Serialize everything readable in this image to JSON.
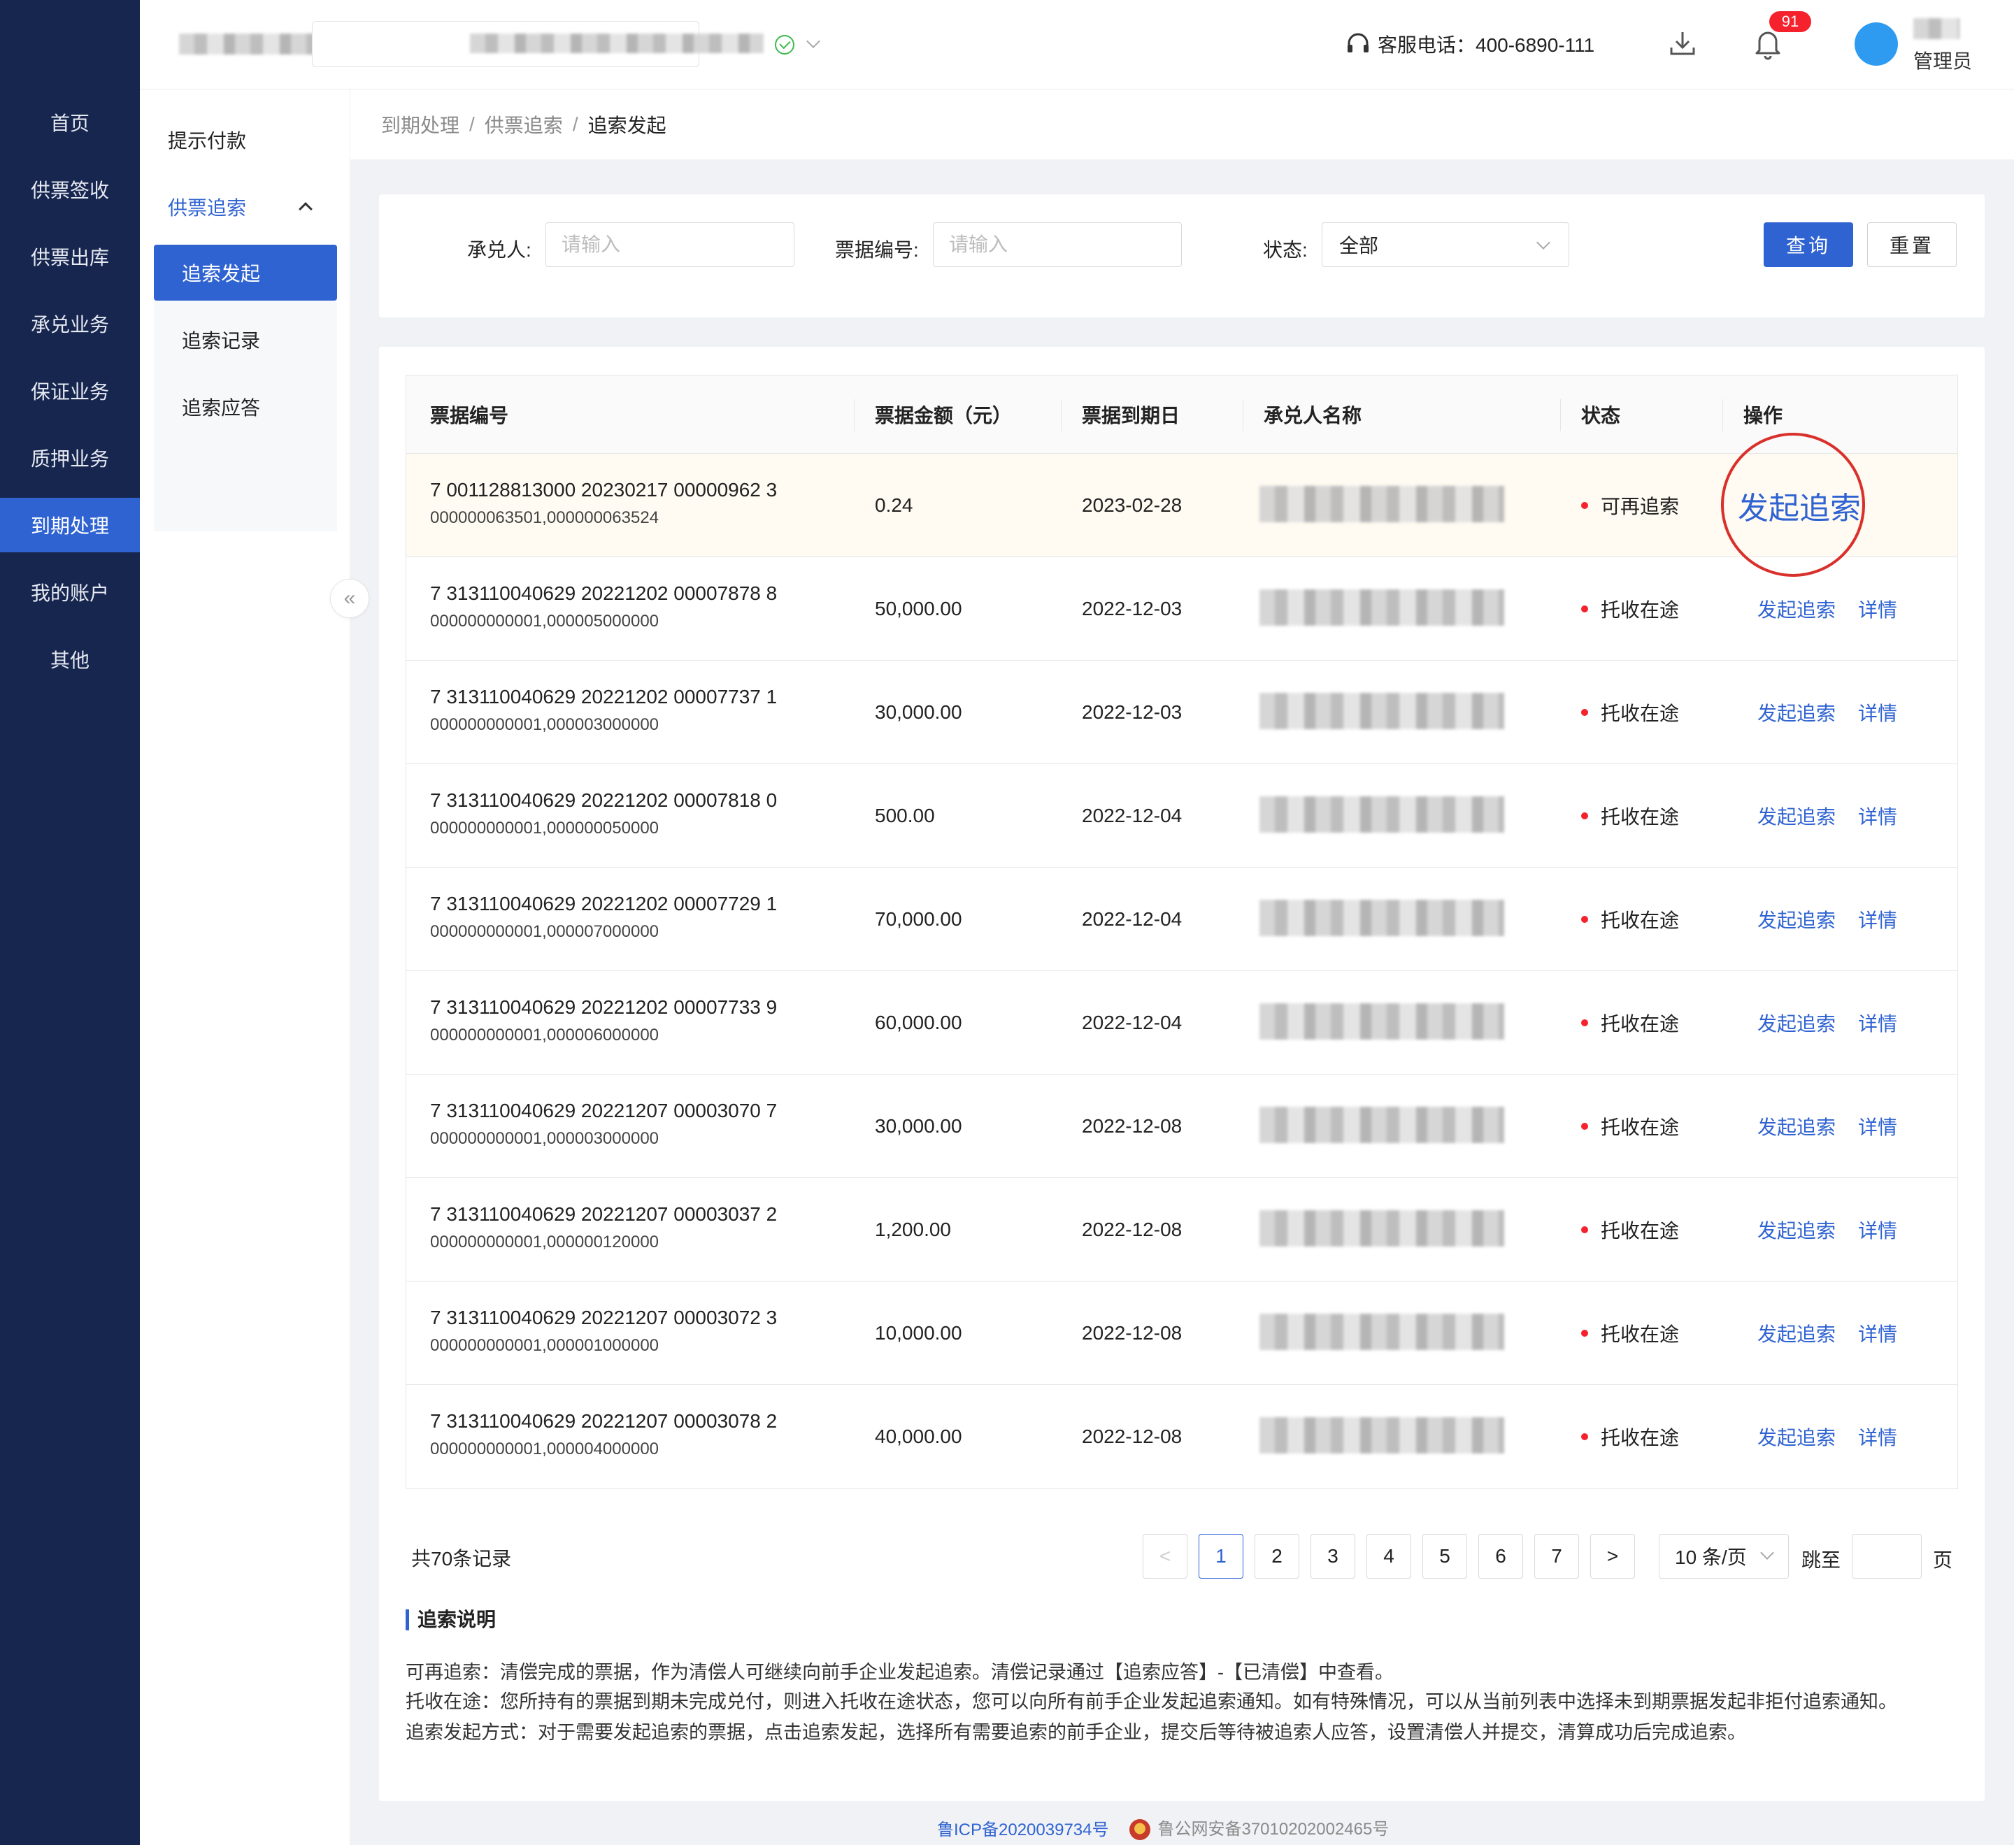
{
  "left_nav": [
    {
      "label": "首页"
    },
    {
      "label": "供票签收"
    },
    {
      "label": "供票出库"
    },
    {
      "label": "承兑业务"
    },
    {
      "label": "保证业务"
    },
    {
      "label": "质押业务"
    },
    {
      "label": "到期处理",
      "active": true
    },
    {
      "label": "我的账户"
    },
    {
      "label": "其他"
    }
  ],
  "header": {
    "hotline": "客服电话：400-6890-111",
    "notification_count": "91",
    "user_role": "管理员"
  },
  "sub_nav": {
    "item_prompt_payment": "提示付款",
    "group_recourse": "供票追索",
    "children": [
      {
        "label": "追索发起",
        "active": true
      },
      {
        "label": "追索记录"
      },
      {
        "label": "追索应答"
      }
    ],
    "collapse_glyph": "«"
  },
  "breadcrumb": [
    "到期处理",
    "供票追索",
    "追索发起"
  ],
  "breadcrumb_sep": "/",
  "filters": {
    "acceptor_label": "承兑人:",
    "acceptor_placeholder": "请输入",
    "bill_no_label": "票据编号:",
    "bill_no_placeholder": "请输入",
    "status_label": "状态:",
    "status_value": "全部",
    "query_button": "查询",
    "reset_button": "重置"
  },
  "table": {
    "columns": [
      "票据编号",
      "票据金额（元）",
      "票据到期日",
      "承兑人名称",
      "状态",
      "操作"
    ],
    "rows": [
      {
        "no": "7 001128813000 20230217 00000962 3",
        "range": "000000063501,000000063524",
        "amount": "0.24",
        "due": "2023-02-28",
        "status": "可再追索",
        "action": "发起追索",
        "detail": ""
      },
      {
        "no": "7 313110040629 20221202 00007878 8",
        "range": "000000000001,000005000000",
        "amount": "50,000.00",
        "due": "2022-12-03",
        "status": "托收在途",
        "action": "发起追索",
        "detail": "详情"
      },
      {
        "no": "7 313110040629 20221202 00007737 1",
        "range": "000000000001,000003000000",
        "amount": "30,000.00",
        "due": "2022-12-03",
        "status": "托收在途",
        "action": "发起追索",
        "detail": "详情"
      },
      {
        "no": "7 313110040629 20221202 00007818 0",
        "range": "000000000001,000000050000",
        "amount": "500.00",
        "due": "2022-12-04",
        "status": "托收在途",
        "action": "发起追索",
        "detail": "详情"
      },
      {
        "no": "7 313110040629 20221202 00007729 1",
        "range": "000000000001,000007000000",
        "amount": "70,000.00",
        "due": "2022-12-04",
        "status": "托收在途",
        "action": "发起追索",
        "detail": "详情"
      },
      {
        "no": "7 313110040629 20221202 00007733 9",
        "range": "000000000001,000006000000",
        "amount": "60,000.00",
        "due": "2022-12-04",
        "status": "托收在途",
        "action": "发起追索",
        "detail": "详情"
      },
      {
        "no": "7 313110040629 20221207 00003070 7",
        "range": "000000000001,000003000000",
        "amount": "30,000.00",
        "due": "2022-12-08",
        "status": "托收在途",
        "action": "发起追索",
        "detail": "详情"
      },
      {
        "no": "7 313110040629 20221207 00003037 2",
        "range": "000000000001,000000120000",
        "amount": "1,200.00",
        "due": "2022-12-08",
        "status": "托收在途",
        "action": "发起追索",
        "detail": "详情"
      },
      {
        "no": "7 313110040629 20221207 00003072 3",
        "range": "000000000001,000001000000",
        "amount": "10,000.00",
        "due": "2022-12-08",
        "status": "托收在途",
        "action": "发起追索",
        "detail": "详情"
      },
      {
        "no": "7 313110040629 20221207 00003078 2",
        "range": "000000000001,000004000000",
        "amount": "40,000.00",
        "due": "2022-12-08",
        "status": "托收在途",
        "action": "发起追索",
        "detail": "详情"
      }
    ]
  },
  "pagination": {
    "total": "共70条记录",
    "prev": "<",
    "next": ">",
    "pages": [
      "1",
      "2",
      "3",
      "4",
      "5",
      "6",
      "7"
    ],
    "current": "1",
    "page_size": "10 条/页",
    "jump_label": "跳至",
    "jump_unit": "页"
  },
  "notes": {
    "title": "追索说明",
    "lines": [
      "可再追索：清偿完成的票据，作为清偿人可继续向前手企业发起追索。清偿记录通过【追索应答】-【已清偿】中查看。",
      "托收在途：您所持有的票据到期未完成兑付，则进入托收在途状态，您可以向所有前手企业发起追索通知。如有特殊情况，可以从当前列表中选择未到期票据发起非拒付追索通知。",
      "追索发起方式：对于需要发起追索的票据，点击追索发起，选择所有需要追索的前手企业，提交后等待被追索人应答，设置清偿人并提交，清算成功后完成追索。"
    ]
  },
  "footer": {
    "icp": "鲁ICP备2020039734号",
    "police": "鲁公网安备37010202002465号"
  },
  "colors": {
    "nav_bg": "#17264f",
    "primary": "#2f63d1",
    "danger": "#f5222d",
    "highlight_row": "#fffaf2"
  }
}
